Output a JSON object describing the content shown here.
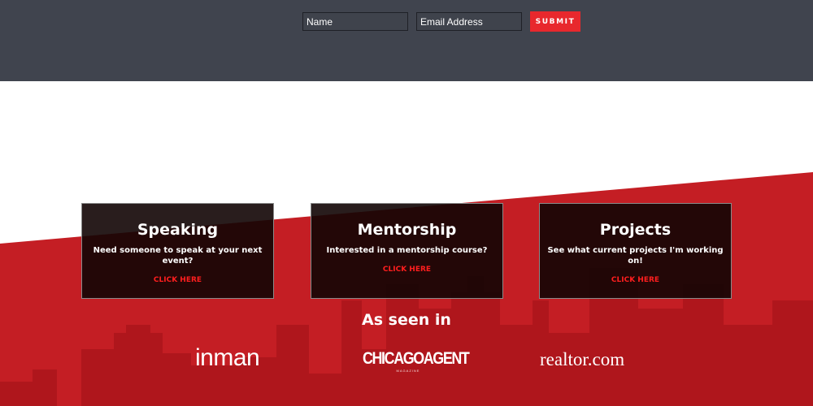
{
  "signup": {
    "name_placeholder": "Name",
    "email_placeholder": "Email Address",
    "submit_label": "SUBMIT"
  },
  "cards": [
    {
      "title": "Speaking",
      "description": "Need someone to speak at your next event?",
      "link": "CLICK HERE"
    },
    {
      "title": "Mentorship",
      "description": "Interested in a mentorship course?",
      "link": "CLICK HERE"
    },
    {
      "title": "Projects",
      "description": "See what current projects I'm working on!",
      "link": "CLICK HERE"
    }
  ],
  "press": {
    "heading": "As seen in",
    "logos": {
      "inman": "inman",
      "chicago_main": "CHICAGOAGENT",
      "chicago_sub": "MAGAZINE",
      "realtor": "realtor.com"
    }
  },
  "colors": {
    "topbar": "#40444e",
    "accent_red": "#c41e24",
    "submit_red": "#e8282d",
    "link_red": "#ff1e1e"
  }
}
